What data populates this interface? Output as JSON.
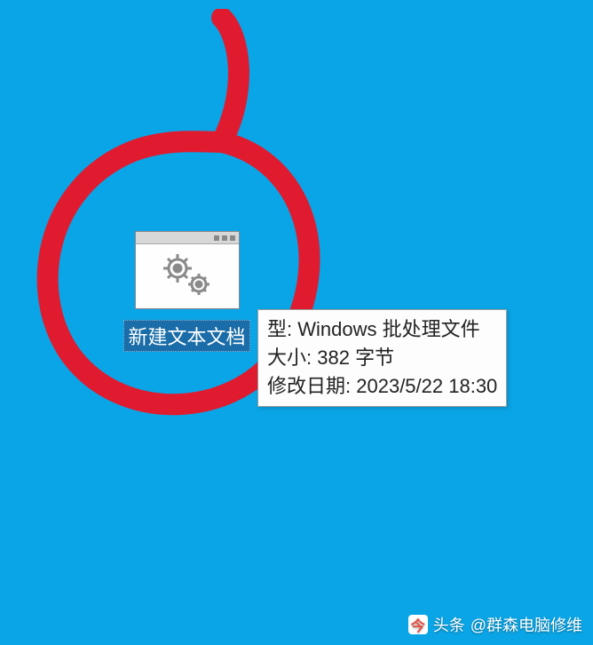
{
  "desktop": {
    "icon": {
      "name": "batch-file-icon",
      "label": "新建文本文档"
    }
  },
  "tooltip": {
    "type_label": "型",
    "type_value": "Windows 批处理文件",
    "size_label": "大小",
    "size_value": "382 字节",
    "modified_label": "修改日期",
    "modified_value": "2023/5/22 18:30"
  },
  "watermark": {
    "prefix": "头条",
    "author": "@群森电脑修维"
  },
  "annotation": {
    "color": "#e01b2f"
  }
}
